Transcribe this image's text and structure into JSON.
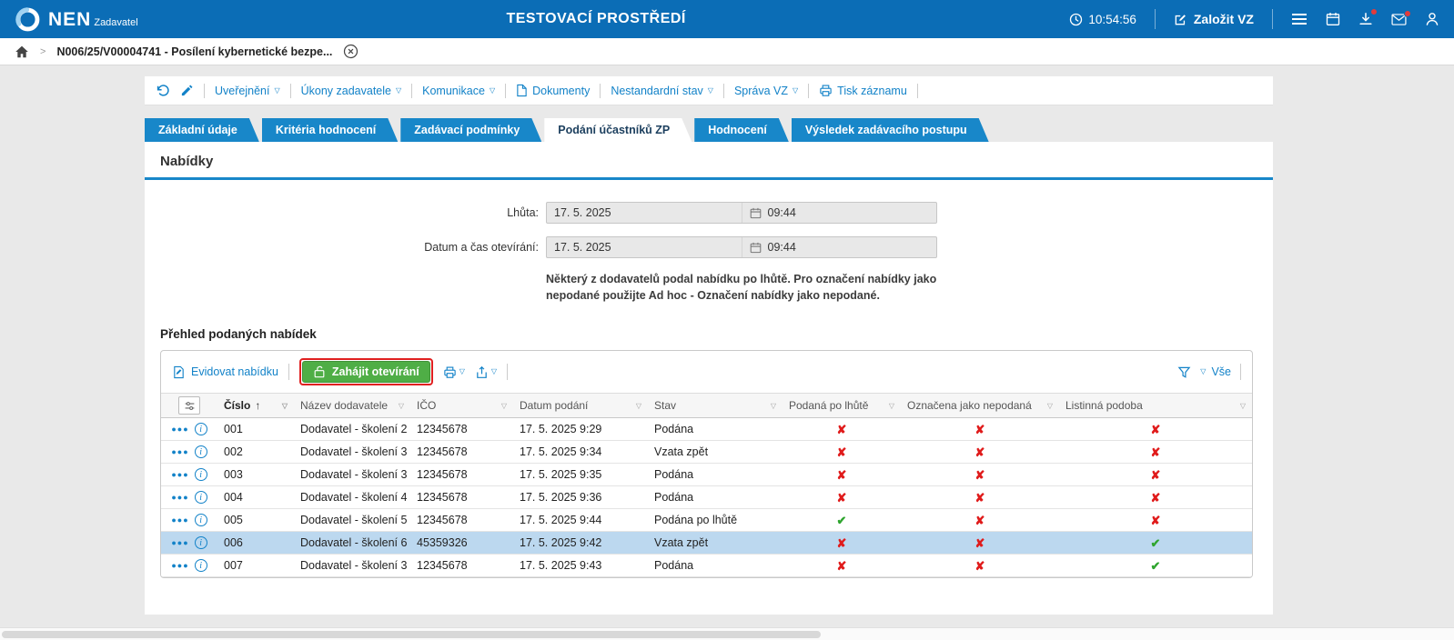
{
  "header": {
    "app_name": "NEN",
    "app_role": "Zadavatel",
    "env_title": "TESTOVACÍ PROSTŘEDÍ",
    "clock": "10:54:56",
    "create_vz_label": "Založit VZ"
  },
  "breadcrumb": {
    "record": "N006/25/V00004741 - Posílení kybernetické bezpe..."
  },
  "record_toolbar": {
    "items": [
      {
        "label": "Uveřejnění",
        "caret": true
      },
      {
        "label": "Úkony zadavatele",
        "caret": true
      },
      {
        "label": "Komunikace",
        "caret": true
      },
      {
        "label": "Dokumenty",
        "caret": false
      },
      {
        "label": "Nestandardní stav",
        "caret": true
      },
      {
        "label": "Správa VZ",
        "caret": true
      },
      {
        "label": "Tisk záznamu",
        "caret": false
      }
    ]
  },
  "tabs": [
    {
      "label": "Základní údaje",
      "active": false
    },
    {
      "label": "Kritéria hodnocení",
      "active": false
    },
    {
      "label": "Zadávací podmínky",
      "active": false
    },
    {
      "label": "Podání účastníků ZP",
      "active": true
    },
    {
      "label": "Hodnocení",
      "active": false
    },
    {
      "label": "Výsledek zadávacího postupu",
      "active": false
    }
  ],
  "offers_section": {
    "title": "Nabídky",
    "deadline_label": "Lhůta:",
    "deadline_date": "17. 5. 2025",
    "deadline_time": "09:44",
    "opening_label": "Datum a čas otevírání:",
    "opening_date": "17. 5. 2025",
    "opening_time": "09:44",
    "warning": "Některý z dodavatelů podal nabídku po lhůtě. Pro označení nabídky jako nepodané použijte Ad hoc - Označení nabídky jako nepodané."
  },
  "offers_table": {
    "title": "Přehled podaných nabídek",
    "actions": {
      "register": "Evidovat nabídku",
      "start_opening": "Zahájit otevírání",
      "filter_all": "Vše"
    },
    "columns": [
      "Číslo",
      "Název dodavatele",
      "IČO",
      "Datum podání",
      "Stav",
      "Podaná po lhůtě",
      "Označena jako nepodaná",
      "Listinná podoba"
    ],
    "marks": {
      "yes": "✔",
      "no": "✘"
    },
    "rows": [
      {
        "number": "001",
        "supplier": "Dodavatel - školení 2",
        "ico": "12345678",
        "submitted": "17. 5. 2025 9:29",
        "status": "Podána",
        "late": false,
        "marked_not_submitted": false,
        "paper_form": false,
        "selected": false
      },
      {
        "number": "002",
        "supplier": "Dodavatel - školení 3",
        "ico": "12345678",
        "submitted": "17. 5. 2025 9:34",
        "status": "Vzata zpět",
        "late": false,
        "marked_not_submitted": false,
        "paper_form": false,
        "selected": false
      },
      {
        "number": "003",
        "supplier": "Dodavatel - školení 3",
        "ico": "12345678",
        "submitted": "17. 5. 2025 9:35",
        "status": "Podána",
        "late": false,
        "marked_not_submitted": false,
        "paper_form": false,
        "selected": false
      },
      {
        "number": "004",
        "supplier": "Dodavatel - školení 4",
        "ico": "12345678",
        "submitted": "17. 5. 2025 9:36",
        "status": "Podána",
        "late": false,
        "marked_not_submitted": false,
        "paper_form": false,
        "selected": false
      },
      {
        "number": "005",
        "supplier": "Dodavatel - školení 5",
        "ico": "12345678",
        "submitted": "17. 5. 2025 9:44",
        "status": "Podána po lhůtě",
        "late": true,
        "marked_not_submitted": false,
        "paper_form": false,
        "selected": false
      },
      {
        "number": "006",
        "supplier": "Dodavatel - školení 6",
        "ico": "45359326",
        "submitted": "17. 5. 2025 9:42",
        "status": "Vzata zpět",
        "late": false,
        "marked_not_submitted": false,
        "paper_form": true,
        "selected": true
      },
      {
        "number": "007",
        "supplier": "Dodavatel - školení 3",
        "ico": "12345678",
        "submitted": "17. 5. 2025 9:43",
        "status": "Podána",
        "late": false,
        "marked_not_submitted": false,
        "paper_form": true,
        "selected": false
      }
    ]
  },
  "colors": {
    "header_blue": "#0b6db6",
    "tab_blue": "#1887c9",
    "link_blue": "#1282c8",
    "green_button": "#4fae46",
    "highlight_red": "#e02020",
    "mark_no": "#e01b1b",
    "mark_yes": "#2fa52f",
    "selected_row": "#bcd8ef"
  }
}
